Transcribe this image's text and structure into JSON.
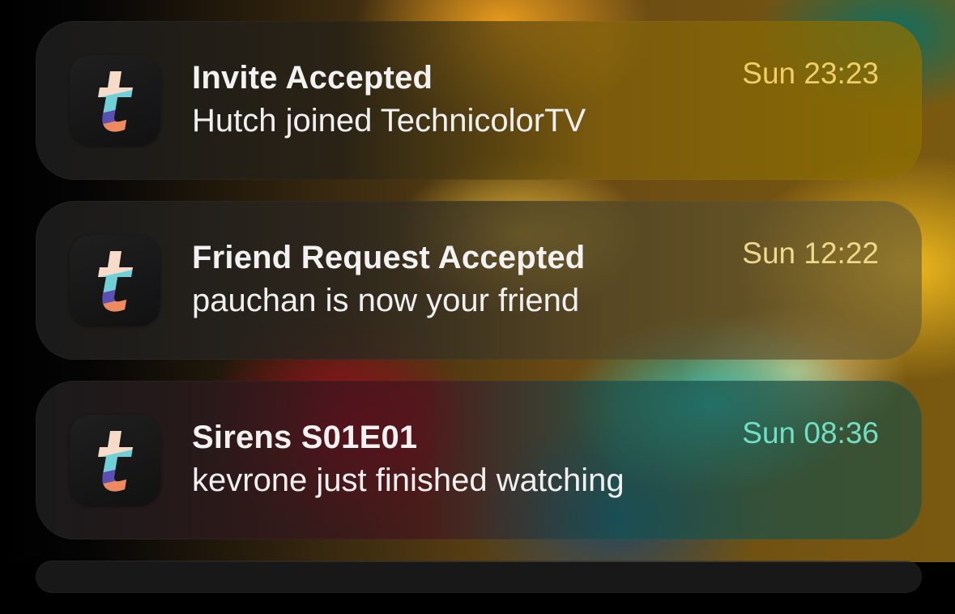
{
  "notifications": [
    {
      "title": "Invite Accepted",
      "body": "Hutch joined TechnicolorTV",
      "time": "Sun 23:23",
      "time_color": "#f0cf6a",
      "app_icon": "technicolortv-app-icon"
    },
    {
      "title": "Friend Request Accepted",
      "body": "pauchan is now your friend",
      "time": "Sun 12:22",
      "time_color": "#ecd98a",
      "app_icon": "technicolortv-app-icon"
    },
    {
      "title": "Sirens S01E01",
      "body": "kevrone just finished watching",
      "time": "Sun 08:36",
      "time_color": "#6fe0c4",
      "app_icon": "technicolortv-app-icon"
    }
  ]
}
